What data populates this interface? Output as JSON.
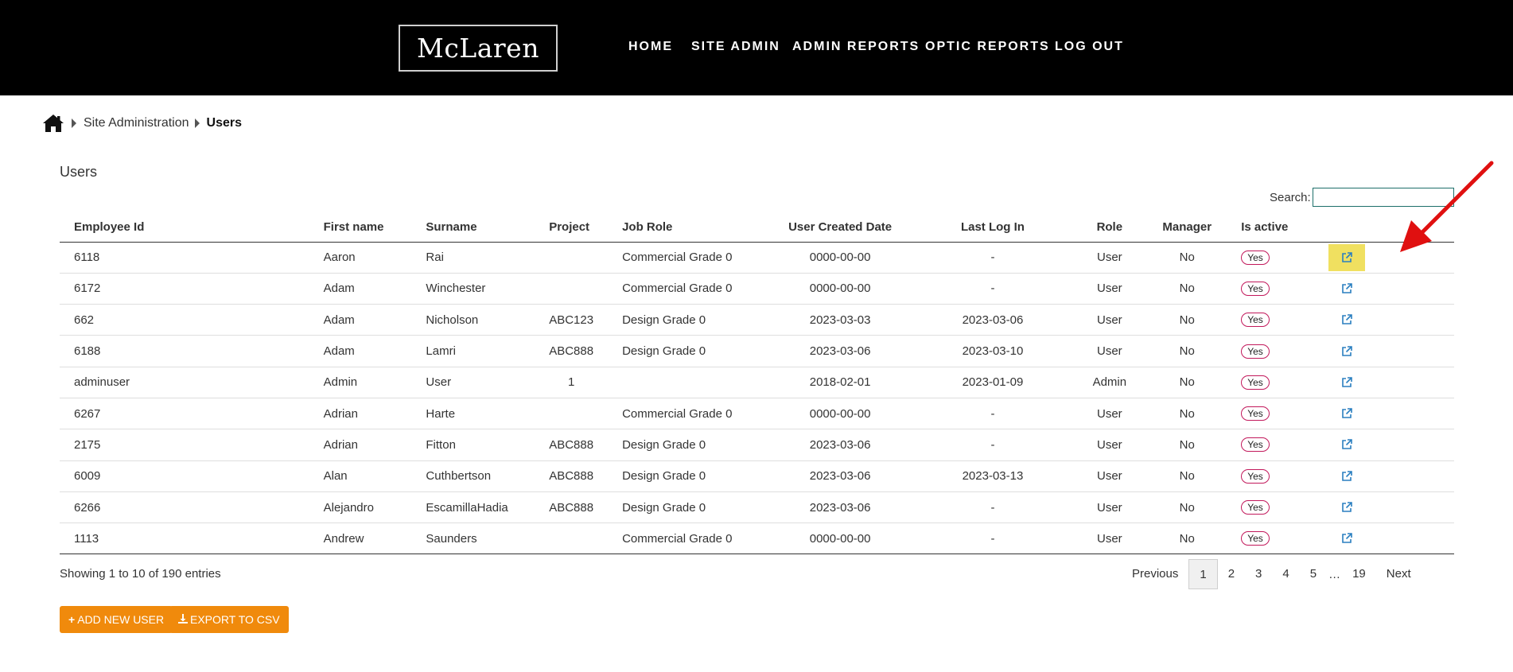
{
  "brand": {
    "logo_text": "McLaren"
  },
  "nav": {
    "items": [
      "HOME",
      "SITE ADMIN",
      "ADMIN REPORTS",
      "OPTIC REPORTS",
      "LOG OUT"
    ]
  },
  "breadcrumb": {
    "icon": "home-icon",
    "parent": "Site Administration",
    "current": "Users"
  },
  "page": {
    "title": "Users"
  },
  "search": {
    "label": "Search:",
    "value": "",
    "placeholder": ""
  },
  "table": {
    "headers": [
      "Employee Id",
      "First name",
      "Surname",
      "Project",
      "Job Role",
      "User Created Date",
      "Last Log In",
      "Role",
      "Manager",
      "Is active",
      ""
    ],
    "rows": [
      [
        "6118",
        "Aaron",
        "Rai",
        "",
        "Commercial Grade 0",
        "0000-00-00",
        "-",
        "User",
        "No",
        "Yes"
      ],
      [
        "6172",
        "Adam",
        "Winchester",
        "",
        "Commercial Grade 0",
        "0000-00-00",
        "-",
        "User",
        "No",
        "Yes"
      ],
      [
        "662",
        "Adam",
        "Nicholson",
        "ABC123",
        "Design Grade 0",
        "2023-03-03",
        "2023-03-06",
        "User",
        "No",
        "Yes"
      ],
      [
        "6188",
        "Adam",
        "Lamri",
        "ABC888",
        "Design Grade 0",
        "2023-03-06",
        "2023-03-10",
        "User",
        "No",
        "Yes"
      ],
      [
        "adminuser",
        "Admin",
        "User",
        "1",
        "",
        "2018-02-01",
        "2023-01-09",
        "Admin",
        "No",
        "Yes"
      ],
      [
        "6267",
        "Adrian",
        "Harte",
        "",
        "Commercial Grade 0",
        "0000-00-00",
        "-",
        "User",
        "No",
        "Yes"
      ],
      [
        "2175",
        "Adrian",
        "Fitton",
        "ABC888",
        "Design Grade 0",
        "2023-03-06",
        "-",
        "User",
        "No",
        "Yes"
      ],
      [
        "6009",
        "Alan",
        "Cuthbertson",
        "ABC888",
        "Design Grade 0",
        "2023-03-06",
        "2023-03-13",
        "User",
        "No",
        "Yes"
      ],
      [
        "6266",
        "Alejandro",
        "EscamillaHadia",
        "ABC888",
        "Design Grade 0",
        "2023-03-06",
        "-",
        "User",
        "No",
        "Yes"
      ],
      [
        "1113",
        "Andrew",
        "Saunders",
        "",
        "Commercial Grade 0",
        "0000-00-00",
        "-",
        "User",
        "No",
        "Yes"
      ]
    ],
    "action_icon": "external-link-icon",
    "highlighted_row": 0
  },
  "info": {
    "text": "Showing 1 to 10 of 190 entries"
  },
  "pagination": {
    "previous": "Previous",
    "pages": [
      "1",
      "2",
      "3",
      "4",
      "5"
    ],
    "ellipsis": "…",
    "last": "19",
    "next": "Next",
    "active": "1"
  },
  "buttons": {
    "add_user": "ADD NEW USER",
    "export": "EXPORT TO CSV"
  },
  "colors": {
    "header_bg": "#000000",
    "accent": "#f08a0c",
    "badge_border": "#c2185b",
    "link_icon": "#2a7fc0",
    "highlight": "#f0e060",
    "annotation_arrow": "#e01010"
  }
}
